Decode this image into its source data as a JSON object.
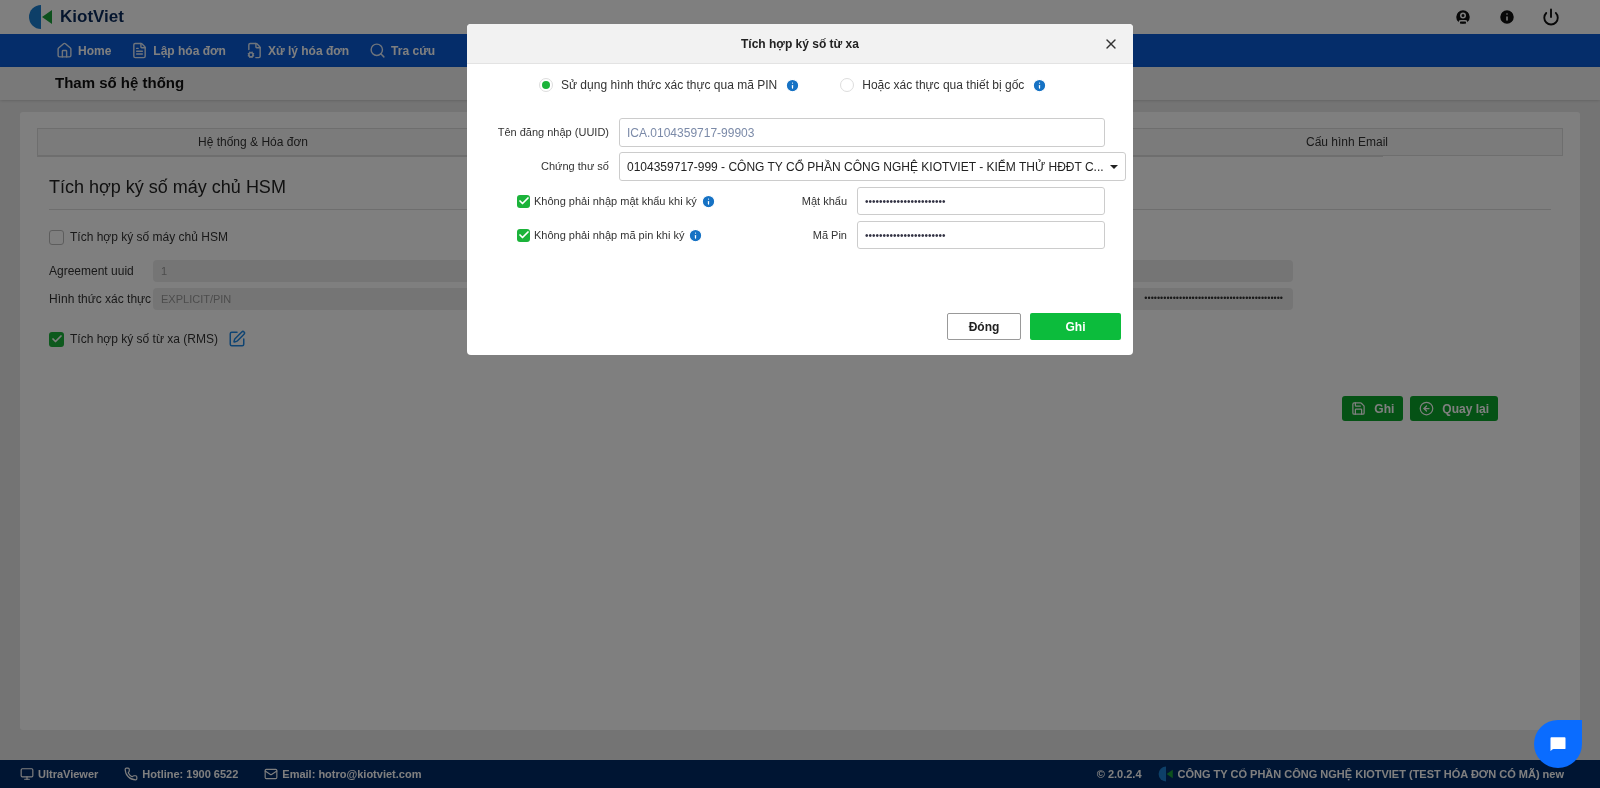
{
  "header": {
    "brand": "KiotViet"
  },
  "nav": [
    {
      "label": "Home"
    },
    {
      "label": "Lập hóa đơn"
    },
    {
      "label": "Xử lý hóa đơn"
    },
    {
      "label": "Tra cứu"
    }
  ],
  "page_title": "Tham số hệ thống",
  "tabs": [
    {
      "label": "Hệ thống & Hóa đơn"
    },
    {
      "label": "Cấu hình Email"
    }
  ],
  "section": {
    "title": "Tích hợp ký số máy chủ HSM",
    "hsm_checkbox": {
      "label": "Tích hợp ký số máy chủ HSM",
      "checked": false
    },
    "fields": [
      {
        "label": "Agreement uuid",
        "value": "1",
        "disabled": true
      },
      {
        "label": "Hình thức xác thực",
        "value": "EXPLICIT/PIN",
        "disabled": true,
        "secret": "••••••••••••••••••••••••••••••••••••••••••••"
      }
    ],
    "rms_checkbox": {
      "label": "Tích hợp ký số từ xa (RMS)",
      "checked": true
    },
    "buttons": [
      {
        "label": "Ghi",
        "kind": "save"
      },
      {
        "label": "Quay lại",
        "kind": "back"
      }
    ]
  },
  "dialog": {
    "title": "Tích hợp ký số từ xa",
    "radios": [
      {
        "label": "Sử dụng hình thức xác thực qua mã PIN",
        "selected": true
      },
      {
        "label": "Hoặc xác thực qua thiết bị gốc",
        "selected": false
      }
    ],
    "username": {
      "label": "Tên đăng nhập (UUID)",
      "value": "ICA.0104359717-99903"
    },
    "certificate": {
      "label": "Chứng thư số",
      "value": "0104359717-999 - CÔNG TY CỔ PHẦN CÔNG NGHỆ KIOTVIET - KIỂM THỬ HĐĐT C..."
    },
    "options": [
      {
        "label": "Không phải nhập mật khẩu khi ký",
        "checked": true,
        "field_label": "Mật khẩu",
        "value": "•••••••••••••••••••••••"
      },
      {
        "label": "Không phải nhập mã pin khi ký",
        "checked": true,
        "field_label": "Mã Pin",
        "value": "•••••••••••••••••••••••"
      }
    ],
    "buttons": [
      {
        "label": "Đóng",
        "kind": "secondary"
      },
      {
        "label": "Ghi",
        "kind": "primary"
      }
    ]
  },
  "footer": {
    "left": [
      {
        "label": "UltraViewer"
      },
      {
        "label": "Hotline: 1900 6522"
      },
      {
        "label": "Email: hotro@kiotviet.com"
      }
    ],
    "version": "© 2.0.2.4",
    "company": "CÔNG TY CỔ PHẦN CÔNG NGHỆ KIOTVIET (TEST HÓA ĐƠN CÓ MÃ) new"
  }
}
